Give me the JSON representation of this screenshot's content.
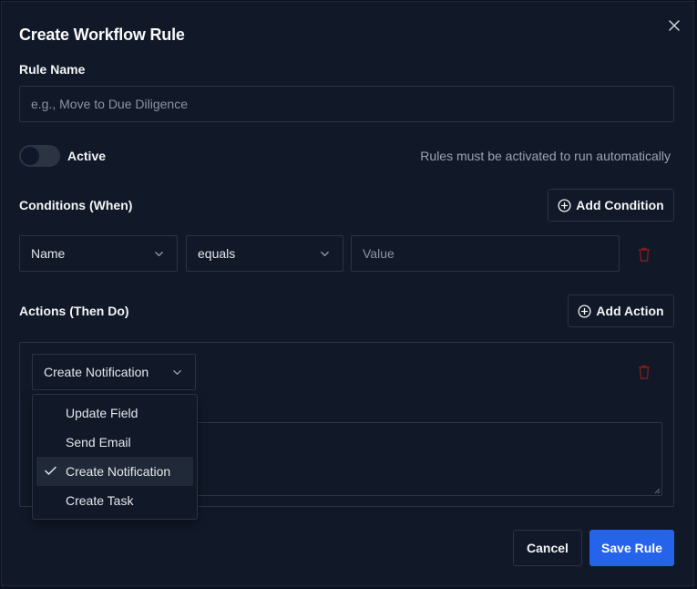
{
  "modal": {
    "title": "Create Workflow Rule"
  },
  "rule_name": {
    "label": "Rule Name",
    "value": "",
    "placeholder": "e.g., Move to Due Diligence"
  },
  "active": {
    "label": "Active",
    "enabled": false,
    "hint": "Rules must be activated to run automatically"
  },
  "conditions": {
    "label": "Conditions (When)",
    "add_label": "Add Condition",
    "rows": [
      {
        "field": "Name",
        "operator": "equals",
        "value": "",
        "value_placeholder": "Value"
      }
    ]
  },
  "actions": {
    "label": "Actions (Then Do)",
    "add_label": "Add Action",
    "rows": [
      {
        "type": "Create Notification",
        "message": ""
      }
    ],
    "dropdown_options": [
      {
        "label": "Update Field",
        "selected": false
      },
      {
        "label": "Send Email",
        "selected": false
      },
      {
        "label": "Create Notification",
        "selected": true
      },
      {
        "label": "Create Task",
        "selected": false
      }
    ]
  },
  "footer": {
    "cancel_label": "Cancel",
    "save_label": "Save Rule"
  },
  "colors": {
    "background": "#111827",
    "border": "#2b3442",
    "primary": "#2563eb",
    "danger": "#7f1d1d"
  },
  "icons": {
    "close": "close-icon",
    "add": "plus-circle-icon",
    "chevron": "chevron-down-icon",
    "delete": "trash-icon",
    "check": "check-icon"
  }
}
